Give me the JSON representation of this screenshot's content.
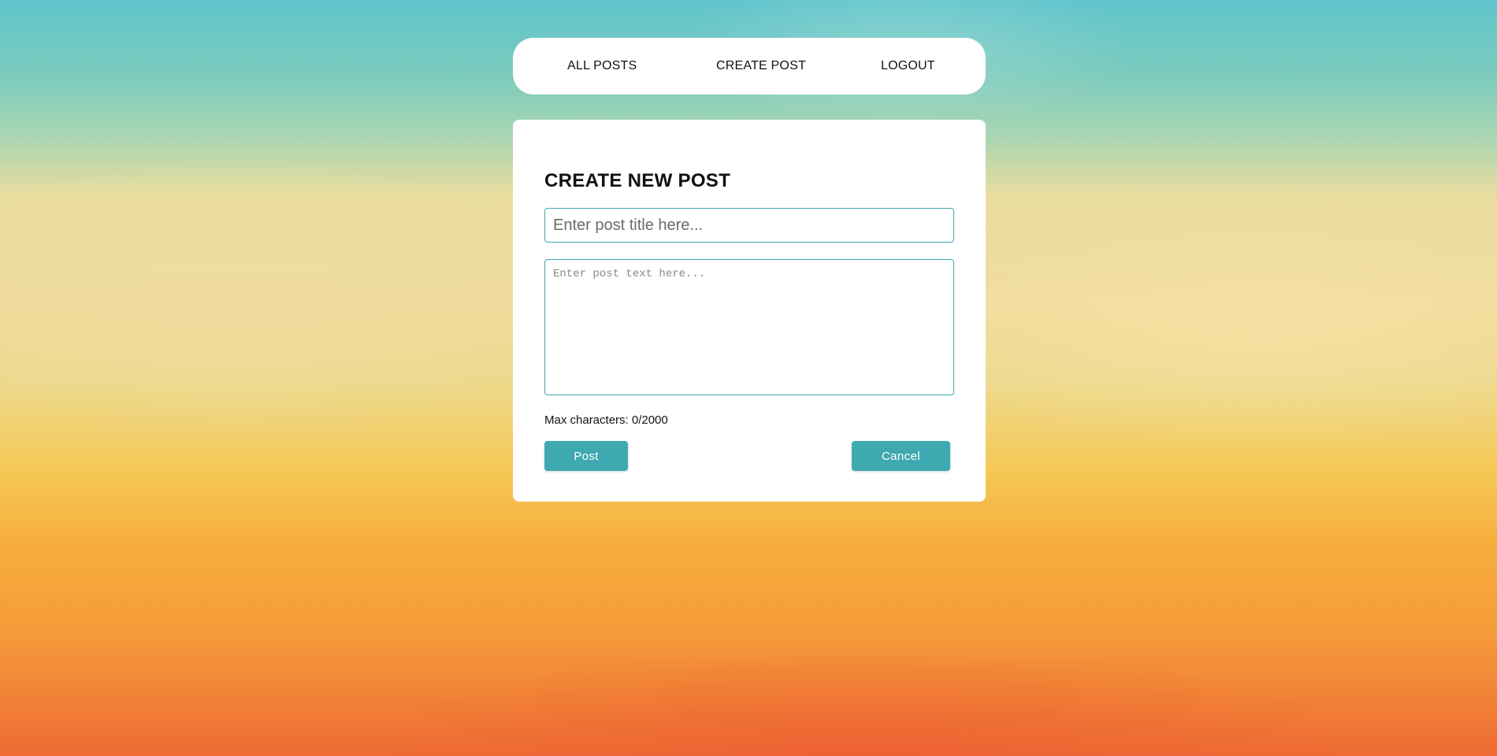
{
  "nav": {
    "items": [
      {
        "label": "ALL POSTS"
      },
      {
        "label": "CREATE POST"
      },
      {
        "label": "LOGOUT"
      }
    ]
  },
  "form": {
    "heading": "CREATE NEW POST",
    "title_input": {
      "value": "",
      "placeholder": "Enter post title here..."
    },
    "text_input": {
      "value": "",
      "placeholder": "Enter post text here..."
    },
    "char_count": "Max characters: 0/2000",
    "post_label": "Post",
    "cancel_label": "Cancel"
  },
  "colors": {
    "accent": "#3ea9b0",
    "input_border": "#3aa7ad",
    "card": "#ffffff"
  }
}
